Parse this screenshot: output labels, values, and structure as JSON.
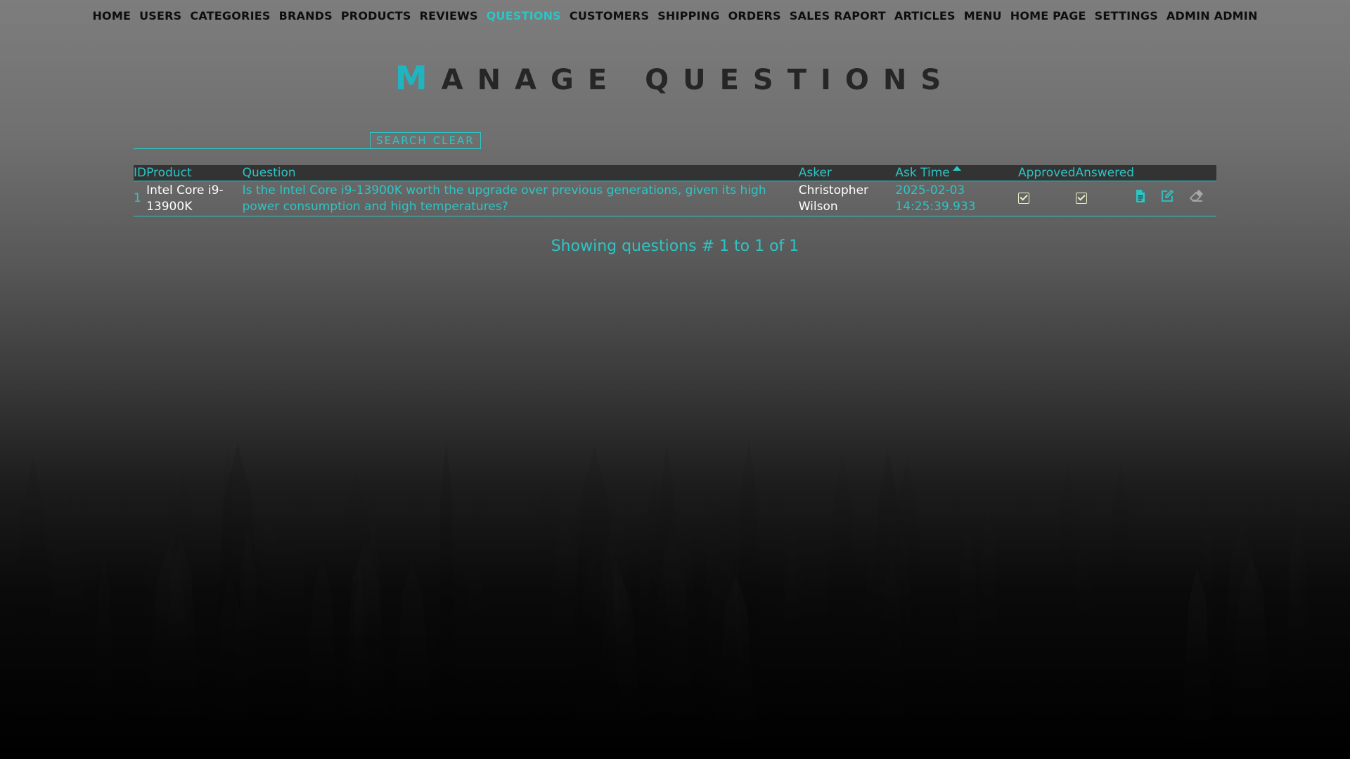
{
  "nav": {
    "items": [
      {
        "label": "HOME",
        "active": false
      },
      {
        "label": "USERS",
        "active": false
      },
      {
        "label": "CATEGORIES",
        "active": false
      },
      {
        "label": "BRANDS",
        "active": false
      },
      {
        "label": "PRODUCTS",
        "active": false
      },
      {
        "label": "REVIEWS",
        "active": false
      },
      {
        "label": "QUESTIONS",
        "active": true
      },
      {
        "label": "CUSTOMERS",
        "active": false
      },
      {
        "label": "SHIPPING",
        "active": false
      },
      {
        "label": "ORDERS",
        "active": false
      },
      {
        "label": "SALES RAPORT",
        "active": false
      },
      {
        "label": "ARTICLES",
        "active": false
      },
      {
        "label": "MENU",
        "active": false
      },
      {
        "label": "HOME PAGE",
        "active": false
      },
      {
        "label": "SETTINGS",
        "active": false
      },
      {
        "label": "ADMIN ADMIN",
        "active": false
      }
    ]
  },
  "page": {
    "title_first": "M",
    "title_rest": "ANAGE QUESTIONS"
  },
  "search": {
    "value": "",
    "placeholder": "",
    "search_label": "SEARCH",
    "clear_label": "CLEAR"
  },
  "table": {
    "headers": {
      "id": "ID",
      "product": "Product",
      "question": "Question",
      "asker": "Asker",
      "ask_time": "Ask Time",
      "approved": "Approved",
      "answered": "Answered"
    },
    "sort_column": "ask_time",
    "sort_direction": "ascending",
    "rows": [
      {
        "id": "1",
        "product": "Intel Core i9-13900K",
        "question": "Is the Intel Core i9-13900K worth the upgrade over previous generations, given its high power consumption and high temperatures?",
        "asker": "Christopher Wilson",
        "ask_time": "2025-02-03 14:25:39.933",
        "approved": true,
        "answered": true
      }
    ],
    "row_actions": [
      "details-icon",
      "edit-icon",
      "delete-icon"
    ]
  },
  "pager": {
    "text": "Showing questions # 1 to 1 of 1"
  },
  "colors": {
    "accent": "#2ec4c4",
    "nav_text": "#0e0e0e",
    "title_text": "#262626",
    "header_bg": "#333333",
    "check": "#e8f2c8",
    "delete_icon": "#a8a8a8"
  }
}
